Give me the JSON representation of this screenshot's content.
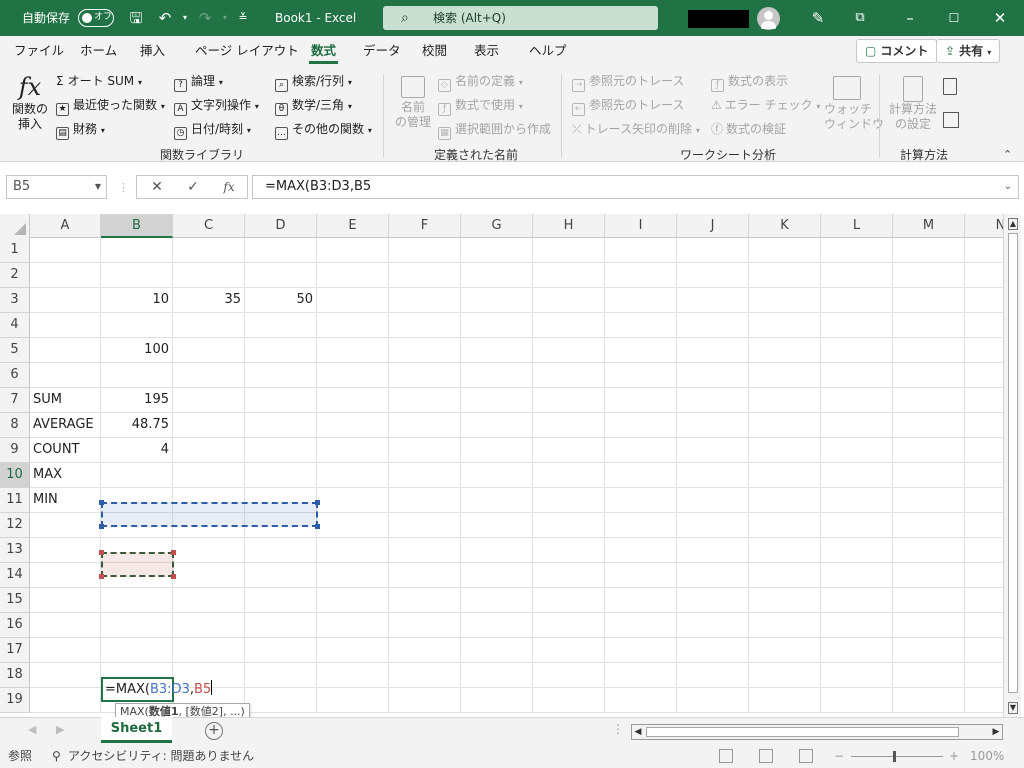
{
  "titlebar": {
    "autosave_label": "自動保存",
    "autosave_state": "オフ",
    "title": "Book1  -  Excel",
    "search_placeholder": "検索 (Alt+Q)",
    "accent_color": "#217346"
  },
  "tabs": [
    "ファイル",
    "ホーム",
    "挿入",
    "ページ レイアウト",
    "数式",
    "データ",
    "校閲",
    "表示",
    "ヘルプ"
  ],
  "active_tab": "数式",
  "tab_buttons": {
    "comment": "コメント",
    "share": "共有"
  },
  "ribbon": {
    "function_library": {
      "insert_function": [
        "関数の",
        "挿入"
      ],
      "autosum": "オート SUM",
      "recently_used": "最近使った関数",
      "financial": "財務",
      "logical": "論理",
      "text": "文字列操作",
      "date_time": "日付/時刻",
      "lookup": "検索/行列",
      "math": "数学/三角",
      "more_functions": "その他の関数",
      "group_label": "関数ライブラリ"
    },
    "defined_names": {
      "name_manager": [
        "名前",
        "の管理"
      ],
      "define_name": "名前の定義",
      "use_in_formula": "数式で使用",
      "create_from_selection": "選択範囲から作成",
      "group_label": "定義された名前"
    },
    "formula_auditing": {
      "trace_precedents": "参照元のトレース",
      "trace_dependents": "参照先のトレース",
      "remove_arrows": "トレース矢印の削除",
      "show_formulas": "数式の表示",
      "error_checking": "エラー チェック",
      "evaluate_formula": "数式の検証",
      "watch_window": [
        "ウォッチ",
        "ウィンドウ"
      ],
      "group_label": "ワークシート分析"
    },
    "calculation": {
      "calc_options": [
        "計算方法",
        "の設定"
      ],
      "group_label": "計算方法"
    }
  },
  "formula_bar": {
    "name_box": "B5",
    "fx": "fx",
    "formula": "=MAX(B3:D3,B5"
  },
  "columns": [
    "A",
    "B",
    "C",
    "D",
    "E",
    "F",
    "G",
    "H",
    "I",
    "J",
    "K",
    "L",
    "M",
    "N"
  ],
  "rows": [
    "1",
    "2",
    "3",
    "4",
    "5",
    "6",
    "7",
    "8",
    "9",
    "10",
    "11",
    "12",
    "13",
    "14",
    "15",
    "16",
    "17",
    "18",
    "19"
  ],
  "cells": {
    "B3": "10",
    "C3": "35",
    "D3": "50",
    "B5": "100",
    "A7": "SUM",
    "B7": "195",
    "A8": "AVERAGE",
    "B8": "48.75",
    "A9": "COUNT",
    "B9": "4",
    "A10": "MAX",
    "A11": "MIN"
  },
  "editing_cell": {
    "ref": "B10",
    "prefix": "=MAX(",
    "ref1": "B3:D3",
    "comma": ",",
    "ref2": "B5",
    "ref1_color": "#4472c4",
    "ref2_color": "#c0504d"
  },
  "tooltip": {
    "fn": "MAX(",
    "arg1": "数値1",
    "rest": ", [数値2], ...)"
  },
  "sheet": {
    "tab": "Sheet1"
  },
  "status": {
    "mode": "参照",
    "accessibility": "アクセシビリティ: 問題ありません",
    "zoom": "100%"
  }
}
